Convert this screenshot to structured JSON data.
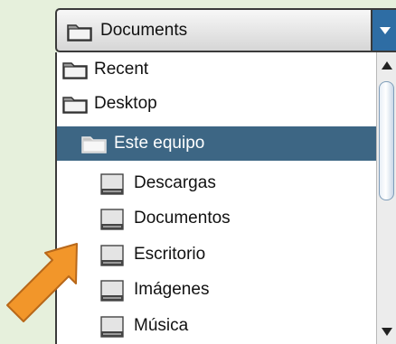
{
  "dropdown": {
    "selected_label": "Documents",
    "arrow_icon": "triangle-down-icon"
  },
  "list": {
    "items": [
      {
        "label": "Recent",
        "icon": "folder-icon",
        "level": 0,
        "selected": false
      },
      {
        "label": "Desktop",
        "icon": "folder-icon",
        "level": 0,
        "selected": false
      },
      {
        "label": "Este equipo",
        "icon": "folder-icon",
        "level": 1,
        "selected": true
      },
      {
        "label": "Descargas",
        "icon": "drive-icon",
        "level": 2,
        "selected": false
      },
      {
        "label": "Documentos",
        "icon": "drive-icon",
        "level": 2,
        "selected": false
      },
      {
        "label": "Escritorio",
        "icon": "drive-icon",
        "level": 2,
        "selected": false
      },
      {
        "label": "Imágenes",
        "icon": "drive-icon",
        "level": 2,
        "selected": false
      },
      {
        "label": "Música",
        "icon": "drive-icon",
        "level": 2,
        "selected": false
      }
    ]
  },
  "colors": {
    "selection": "#3d6684",
    "arrow_button": "#2e6da4",
    "pointer_arrow": "#f2962a",
    "background": "#e6f0dc"
  }
}
